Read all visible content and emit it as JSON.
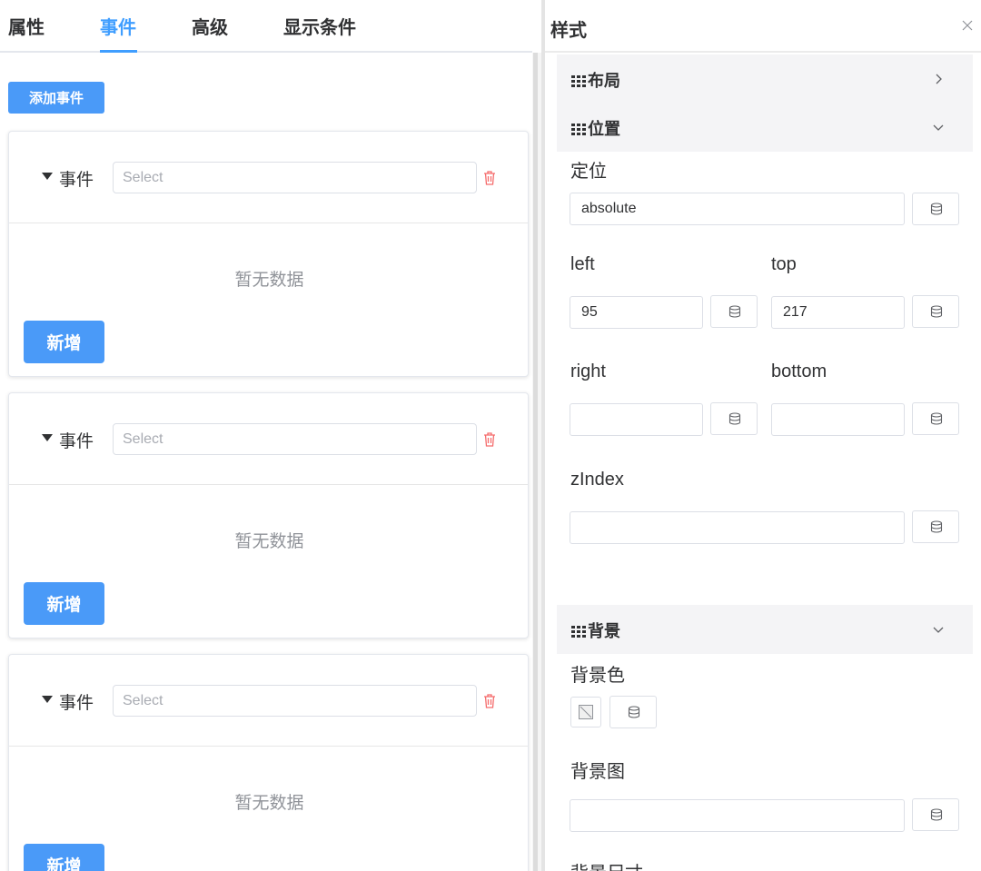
{
  "tabs": [
    {
      "label": "属性"
    },
    {
      "label": "事件"
    },
    {
      "label": "高级"
    },
    {
      "label": "显示条件"
    }
  ],
  "active_tab": "事件",
  "add_event_label": "添加事件",
  "events": [
    {
      "label": "事件",
      "select_placeholder": "Select",
      "empty_text": "暂无数据",
      "new_label": "新增"
    },
    {
      "label": "事件",
      "select_placeholder": "Select",
      "empty_text": "暂无数据",
      "new_label": "新增"
    },
    {
      "label": "事件",
      "select_placeholder": "Select",
      "empty_text": "暂无数据",
      "new_label": "新增"
    }
  ],
  "style_panel": {
    "title": "样式",
    "sections": {
      "layout": {
        "title": "布局",
        "expanded": false
      },
      "position": {
        "title": "位置",
        "expanded": true
      },
      "background": {
        "title": "背景",
        "expanded": true
      }
    },
    "position": {
      "positioning_label": "定位",
      "positioning_value": "absolute",
      "left_label": "left",
      "left_value": "95",
      "top_label": "top",
      "top_value": "217",
      "right_label": "right",
      "right_value": "",
      "bottom_label": "bottom",
      "bottom_value": "",
      "zindex_label": "zIndex",
      "zindex_value": ""
    },
    "background": {
      "color_label": "背景色",
      "image_label": "背景图",
      "image_value": "",
      "size_label": "背景尺寸"
    }
  },
  "colors": {
    "accent": "#409eff",
    "button": "#4a9af8",
    "danger": "#f56c6c"
  },
  "icons": {
    "caret": "caret-down-icon",
    "trash": "trash-icon",
    "database": "database-icon",
    "close": "close-icon",
    "grid": "grid-icon",
    "chevron_right": "chevron-right-icon",
    "chevron_down": "chevron-down-icon"
  }
}
